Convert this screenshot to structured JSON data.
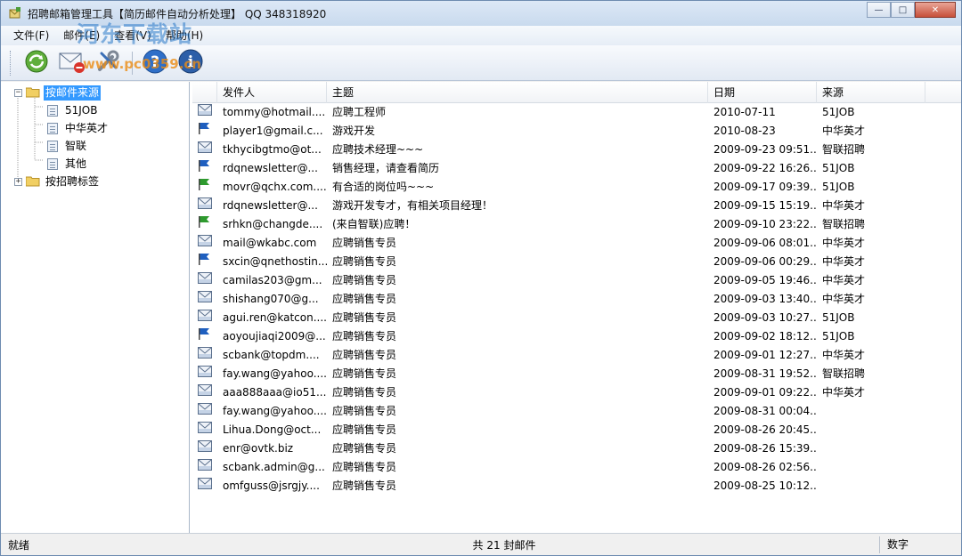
{
  "window": {
    "title": "招聘邮箱管理工具【简历邮件自动分析处理】 QQ 348318920",
    "minimize_glyph": "—",
    "maximize_glyph": "□",
    "close_glyph": "✕"
  },
  "watermark": {
    "text": "河东下载站",
    "url": "www.pc0359.cn"
  },
  "menu": [
    "文件(F)",
    "邮件(E)",
    "查看(V)",
    "帮助(H)"
  ],
  "toolbar": {
    "buttons": [
      {
        "icon": "refresh-globe-icon"
      },
      {
        "icon": "mail-delete-icon"
      },
      {
        "icon": "tools-icon"
      },
      {
        "icon": "help-icon"
      },
      {
        "icon": "info-icon"
      }
    ]
  },
  "tree": {
    "root1": {
      "label": "按邮件来源",
      "expander": "−"
    },
    "children": [
      {
        "label": "51JOB"
      },
      {
        "label": "中华英才"
      },
      {
        "label": "智联"
      },
      {
        "label": "其他"
      }
    ],
    "root2": {
      "label": "按招聘标签",
      "expander": "+"
    }
  },
  "list": {
    "columns": {
      "from": "发件人",
      "subject": "主题",
      "date": "日期",
      "source": "来源"
    },
    "rows": [
      {
        "icon": "mail",
        "from": "tommy@hotmail....",
        "subject": "应聘工程师",
        "date": "2010-07-11",
        "source": "51JOB"
      },
      {
        "icon": "flag-blue",
        "from": "player1@gmail.c...",
        "subject": "游戏开发",
        "date": "2010-08-23",
        "source": "中华英才"
      },
      {
        "icon": "mail",
        "from": "tkhycibgtmo@ot...",
        "subject": "应聘技术经理~~~",
        "date": "2009-09-23 09:51...",
        "source": "智联招聘"
      },
      {
        "icon": "flag-blue",
        "from": "rdqnewsletter@...",
        "subject": "销售经理，请查看简历",
        "date": "2009-09-22 16:26...",
        "source": "51JOB"
      },
      {
        "icon": "flag-green",
        "from": "movr@qchx.com....",
        "subject": "有合适的岗位吗~~~",
        "date": "2009-09-17 09:39...",
        "source": "51JOB"
      },
      {
        "icon": "mail",
        "from": "rdqnewsletter@...",
        "subject": "游戏开发专才，有相关项目经理！",
        "date": "2009-09-15 15:19...",
        "source": "中华英才"
      },
      {
        "icon": "flag-green",
        "from": "srhkn@changde....",
        "subject": "(来自智联)应聘！",
        "date": "2009-09-10 23:22...",
        "source": "智联招聘"
      },
      {
        "icon": "mail",
        "from": "mail@wkabc.com",
        "subject": "应聘销售专员",
        "date": "2009-09-06 08:01...",
        "source": "中华英才"
      },
      {
        "icon": "flag-blue",
        "from": "sxcin@qnethostin...",
        "subject": "应聘销售专员",
        "date": "2009-09-06 00:29...",
        "source": "中华英才"
      },
      {
        "icon": "mail",
        "from": "camilas203@gm...",
        "subject": "应聘销售专员",
        "date": "2009-09-05 19:46...",
        "source": "中华英才"
      },
      {
        "icon": "mail",
        "from": "shishang070@g...",
        "subject": "应聘销售专员",
        "date": "2009-09-03 13:40...",
        "source": "中华英才"
      },
      {
        "icon": "mail",
        "from": "agui.ren@katcon....",
        "subject": "应聘销售专员",
        "date": "2009-09-03 10:27...",
        "source": "51JOB"
      },
      {
        "icon": "flag-blue",
        "from": "aoyoujiaqi2009@...",
        "subject": "应聘销售专员",
        "date": "2009-09-02 18:12...",
        "source": "51JOB"
      },
      {
        "icon": "mail",
        "from": "scbank@topdm....",
        "subject": "应聘销售专员",
        "date": "2009-09-01 12:27...",
        "source": "中华英才"
      },
      {
        "icon": "mail",
        "from": "fay.wang@yahoo....",
        "subject": "应聘销售专员",
        "date": "2009-08-31 19:52...",
        "source": "智联招聘"
      },
      {
        "icon": "mail",
        "from": "aaa888aaa@io51...",
        "subject": "应聘销售专员",
        "date": "2009-09-01 09:22...",
        "source": "中华英才"
      },
      {
        "icon": "mail",
        "from": "fay.wang@yahoo....",
        "subject": "应聘销售专员",
        "date": "2009-08-31 00:04...",
        "source": ""
      },
      {
        "icon": "mail",
        "from": "Lihua.Dong@oct...",
        "subject": "应聘销售专员",
        "date": "2009-08-26 20:45...",
        "source": ""
      },
      {
        "icon": "mail",
        "from": "enr@ovtk.biz",
        "subject": "应聘销售专员",
        "date": "2009-08-26 15:39...",
        "source": ""
      },
      {
        "icon": "mail",
        "from": "scbank.admin@g...",
        "subject": "应聘销售专员",
        "date": "2009-08-26 02:56...",
        "source": ""
      },
      {
        "icon": "mail",
        "from": "omfguss@jsrgjy....",
        "subject": "应聘销售专员",
        "date": "2009-08-25 10:12...",
        "source": ""
      }
    ]
  },
  "status": {
    "left": "就绪",
    "middle": "共 21 封邮件",
    "right": "数字"
  },
  "colors": {
    "selection": "#3399ff",
    "flag_blue": "#1f5fbf",
    "flag_green": "#2e9a2e",
    "titlebar": "#c9daee"
  }
}
